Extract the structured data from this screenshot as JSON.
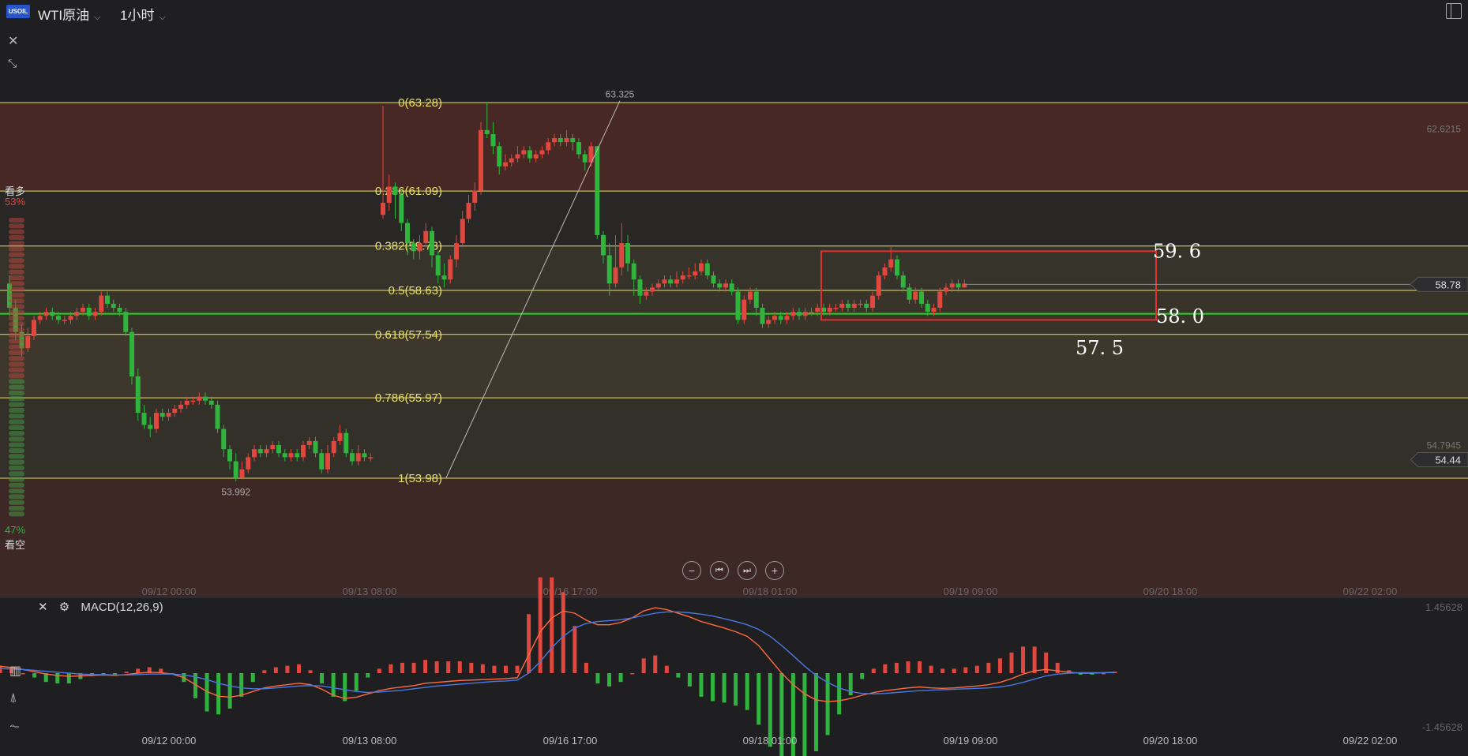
{
  "header": {
    "logo_text": "USOIL",
    "symbol": "WTI原油",
    "timeframe": "1小时"
  },
  "sentiment": {
    "bull_label": "看多",
    "bull_pct": "53%",
    "bear_label": "看空",
    "bear_pct": "47%",
    "bull_fraction": 0.53
  },
  "colors": {
    "up": "#e0473e",
    "down": "#2fb43e",
    "fib_line": "#e6e06a",
    "box": "#e03030",
    "support": "#22d622",
    "macd_fast": "#ff6a3d",
    "macd_slow": "#4a78e0"
  },
  "chart_data": [
    {
      "type": "candlestick",
      "symbol": "WTI原油",
      "interval": "1小时",
      "x_ticks": [
        "09/12 00:00",
        "09/13 08:00",
        "09/16 17:00",
        "09/18 01:00",
        "09/19 09:00",
        "09/20 18:00",
        "09/22 02:00"
      ],
      "y_labels": [
        "62.6215",
        "54.7945"
      ],
      "ylim": [
        51.5,
        65.5
      ],
      "price_tags": [
        {
          "value": 58.78,
          "label": "58.78"
        },
        {
          "value": 54.44,
          "label": "54.44"
        }
      ],
      "fib_levels": [
        {
          "label": "0(63.28)",
          "value": 63.28
        },
        {
          "label": "0.236(61.09)",
          "value": 61.09
        },
        {
          "label": "0.382(59.73)",
          "value": 59.73
        },
        {
          "label": "0.5(58.63)",
          "value": 58.63
        },
        {
          "label": "0.618(57.54)",
          "value": 57.54
        },
        {
          "label": "0.786(55.97)",
          "value": 55.97
        },
        {
          "label": "1(53.98)",
          "value": 53.98
        }
      ],
      "extremes": [
        {
          "label": "63.325",
          "value": 63.325
        },
        {
          "label": "53.992",
          "value": 53.992
        }
      ],
      "annotations": [
        {
          "label": "59. 6",
          "value": 59.6
        },
        {
          "label": "58. 0",
          "value": 58.0
        },
        {
          "label": "57. 5",
          "value": 57.5
        }
      ],
      "support_level": 58.05,
      "range_box": {
        "top": 59.6,
        "bottom": 57.9
      },
      "candles": [
        [
          58.8,
          58.2,
          59.0,
          58.0
        ],
        [
          58.2,
          57.6,
          58.4,
          57.4
        ],
        [
          57.6,
          57.2,
          57.8,
          57.0
        ],
        [
          57.2,
          57.5,
          57.7,
          57.1
        ],
        [
          57.5,
          57.9,
          58.0,
          57.4
        ],
        [
          57.9,
          58.0,
          58.1,
          57.8
        ],
        [
          58.0,
          58.1,
          58.2,
          57.9
        ],
        [
          58.1,
          58.0,
          58.2,
          57.9
        ],
        [
          58.0,
          57.9,
          58.1,
          57.8
        ],
        [
          57.9,
          57.9,
          58.0,
          57.8
        ],
        [
          57.9,
          58.0,
          58.1,
          57.8
        ],
        [
          58.0,
          58.1,
          58.2,
          57.9
        ],
        [
          58.1,
          58.2,
          58.3,
          58.0
        ],
        [
          58.2,
          58.0,
          58.3,
          57.9
        ],
        [
          58.0,
          58.1,
          58.2,
          57.9
        ],
        [
          58.1,
          58.5,
          58.6,
          58.0
        ],
        [
          58.5,
          58.3,
          58.6,
          58.2
        ],
        [
          58.3,
          58.2,
          58.4,
          58.1
        ],
        [
          58.2,
          58.1,
          58.3,
          58.0
        ],
        [
          58.1,
          57.6,
          58.2,
          57.5
        ],
        [
          57.6,
          56.5,
          57.7,
          56.3
        ],
        [
          56.5,
          55.6,
          56.7,
          55.4
        ],
        [
          55.6,
          55.3,
          55.8,
          55.2
        ],
        [
          55.3,
          55.2,
          55.5,
          55.0
        ],
        [
          55.2,
          55.6,
          55.7,
          55.1
        ],
        [
          55.6,
          55.5,
          55.7,
          55.4
        ],
        [
          55.5,
          55.6,
          55.7,
          55.4
        ],
        [
          55.6,
          55.7,
          55.8,
          55.5
        ],
        [
          55.7,
          55.8,
          55.9,
          55.6
        ],
        [
          55.8,
          55.9,
          56.0,
          55.7
        ],
        [
          55.9,
          55.9,
          56.0,
          55.8
        ],
        [
          55.9,
          56.0,
          56.1,
          55.8
        ],
        [
          56.0,
          55.9,
          56.1,
          55.8
        ],
        [
          55.9,
          55.8,
          56.0,
          55.7
        ],
        [
          55.8,
          55.2,
          55.9,
          55.1
        ],
        [
          55.2,
          54.7,
          55.3,
          54.5
        ],
        [
          54.7,
          54.4,
          54.8,
          54.2
        ],
        [
          54.4,
          54.0,
          54.6,
          53.9
        ],
        [
          54.0,
          54.2,
          54.4,
          54.0
        ],
        [
          54.2,
          54.5,
          54.6,
          54.1
        ],
        [
          54.5,
          54.7,
          54.8,
          54.4
        ],
        [
          54.7,
          54.6,
          54.8,
          54.5
        ],
        [
          54.6,
          54.7,
          54.8,
          54.5
        ],
        [
          54.7,
          54.8,
          54.9,
          54.6
        ],
        [
          54.8,
          54.6,
          54.9,
          54.5
        ],
        [
          54.6,
          54.5,
          54.7,
          54.4
        ],
        [
          54.5,
          54.6,
          54.7,
          54.4
        ],
        [
          54.6,
          54.5,
          54.7,
          54.4
        ],
        [
          54.5,
          54.8,
          54.9,
          54.4
        ],
        [
          54.8,
          54.9,
          55.0,
          54.7
        ],
        [
          54.9,
          54.6,
          55.0,
          54.5
        ],
        [
          54.6,
          54.2,
          54.7,
          54.1
        ],
        [
          54.2,
          54.6,
          54.8,
          54.1
        ],
        [
          54.6,
          54.9,
          55.0,
          54.5
        ],
        [
          54.9,
          55.1,
          55.3,
          54.8
        ],
        [
          55.1,
          54.6,
          55.2,
          54.5
        ],
        [
          54.6,
          54.4,
          54.7,
          54.3
        ],
        [
          54.4,
          54.6,
          54.8,
          54.3
        ],
        [
          54.6,
          54.5,
          54.7,
          54.4
        ],
        [
          54.5,
          54.5,
          54.6,
          54.4
        ],
        [
          60.5,
          60.8,
          63.2,
          60.4
        ],
        [
          60.8,
          61.2,
          61.5,
          60.6
        ],
        [
          61.2,
          61.0,
          61.3,
          60.4
        ],
        [
          61.0,
          60.3,
          61.1,
          60.1
        ],
        [
          60.3,
          59.8,
          60.4,
          59.5
        ],
        [
          59.8,
          59.6,
          59.9,
          59.4
        ],
        [
          59.6,
          59.8,
          60.0,
          59.4
        ],
        [
          59.8,
          60.1,
          60.3,
          59.7
        ],
        [
          60.1,
          59.5,
          60.2,
          59.2
        ],
        [
          59.5,
          59.0,
          59.6,
          58.8
        ],
        [
          59.0,
          58.9,
          59.3,
          58.7
        ],
        [
          58.9,
          59.4,
          59.5,
          58.8
        ],
        [
          59.4,
          59.8,
          60.0,
          59.2
        ],
        [
          59.8,
          60.4,
          60.6,
          59.7
        ],
        [
          60.4,
          60.8,
          61.0,
          60.3
        ],
        [
          60.8,
          61.1,
          61.3,
          60.6
        ],
        [
          61.1,
          62.6,
          62.8,
          61.0
        ],
        [
          62.6,
          62.5,
          63.3,
          62.4
        ],
        [
          62.5,
          62.2,
          62.8,
          62.0
        ],
        [
          62.2,
          61.7,
          62.3,
          61.5
        ],
        [
          61.7,
          61.8,
          62.0,
          61.6
        ],
        [
          61.8,
          61.9,
          62.0,
          61.7
        ],
        [
          61.9,
          62.0,
          62.2,
          61.8
        ],
        [
          62.0,
          62.1,
          62.2,
          61.9
        ],
        [
          62.1,
          61.9,
          62.2,
          61.8
        ],
        [
          61.9,
          62.0,
          62.1,
          61.8
        ],
        [
          62.0,
          62.1,
          62.2,
          61.9
        ],
        [
          62.1,
          62.3,
          62.4,
          62.0
        ],
        [
          62.3,
          62.4,
          62.5,
          62.2
        ],
        [
          62.4,
          62.3,
          62.5,
          62.2
        ],
        [
          62.3,
          62.4,
          62.6,
          62.2
        ],
        [
          62.4,
          62.3,
          62.5,
          62.1
        ],
        [
          62.3,
          62.0,
          62.4,
          61.9
        ],
        [
          62.0,
          61.8,
          62.1,
          61.6
        ],
        [
          61.8,
          62.2,
          62.3,
          61.7
        ],
        [
          62.2,
          60.0,
          62.2,
          59.9
        ],
        [
          60.0,
          59.5,
          60.1,
          59.3
        ],
        [
          59.5,
          58.8,
          59.8,
          58.5
        ],
        [
          58.8,
          59.2,
          60.0,
          58.7
        ],
        [
          59.2,
          59.8,
          60.3,
          59.0
        ],
        [
          59.8,
          59.3,
          60.0,
          59.1
        ],
        [
          59.3,
          58.9,
          59.4,
          58.5
        ],
        [
          58.9,
          58.5,
          59.0,
          58.3
        ],
        [
          58.5,
          58.6,
          58.7,
          58.4
        ],
        [
          58.6,
          58.7,
          58.8,
          58.5
        ],
        [
          58.7,
          58.8,
          58.9,
          58.6
        ],
        [
          58.8,
          58.9,
          59.0,
          58.7
        ],
        [
          58.9,
          58.8,
          59.0,
          58.7
        ],
        [
          58.8,
          58.9,
          59.1,
          58.7
        ],
        [
          58.9,
          59.0,
          59.1,
          58.8
        ],
        [
          59.0,
          59.0,
          59.2,
          58.9
        ],
        [
          59.0,
          59.1,
          59.3,
          58.9
        ],
        [
          59.1,
          59.3,
          59.4,
          59.0
        ],
        [
          59.3,
          59.0,
          59.4,
          58.9
        ],
        [
          59.0,
          58.8,
          59.1,
          58.7
        ],
        [
          58.8,
          58.7,
          58.9,
          58.6
        ],
        [
          58.7,
          58.8,
          58.9,
          58.6
        ],
        [
          58.8,
          58.6,
          58.9,
          58.5
        ],
        [
          58.6,
          57.9,
          58.7,
          57.8
        ],
        [
          57.9,
          58.4,
          58.5,
          57.8
        ],
        [
          58.4,
          58.6,
          58.7,
          58.3
        ],
        [
          58.6,
          58.2,
          58.7,
          58.0
        ],
        [
          58.2,
          57.8,
          58.3,
          57.7
        ],
        [
          57.8,
          57.9,
          58.0,
          57.7
        ],
        [
          57.9,
          58.0,
          58.1,
          57.8
        ],
        [
          58.0,
          57.9,
          58.1,
          57.8
        ],
        [
          57.9,
          58.0,
          58.1,
          57.8
        ],
        [
          58.0,
          58.1,
          58.2,
          57.9
        ],
        [
          58.1,
          58.0,
          58.2,
          57.9
        ],
        [
          58.0,
          58.1,
          58.2,
          57.9
        ],
        [
          58.1,
          58.1,
          58.2,
          58.0
        ],
        [
          58.1,
          58.2,
          58.3,
          58.0
        ],
        [
          58.2,
          58.1,
          58.3,
          58.0
        ],
        [
          58.1,
          58.2,
          58.3,
          58.0
        ],
        [
          58.2,
          58.2,
          58.3,
          58.1
        ],
        [
          58.2,
          58.3,
          58.4,
          58.1
        ],
        [
          58.3,
          58.2,
          58.4,
          58.1
        ],
        [
          58.2,
          58.3,
          58.4,
          58.1
        ],
        [
          58.3,
          58.3,
          58.4,
          58.2
        ],
        [
          58.3,
          58.2,
          58.4,
          58.1
        ],
        [
          58.2,
          58.5,
          58.6,
          58.1
        ],
        [
          58.5,
          59.0,
          59.1,
          58.4
        ],
        [
          59.0,
          59.2,
          59.3,
          58.9
        ],
        [
          59.2,
          59.4,
          59.7,
          59.1
        ],
        [
          59.4,
          59.0,
          59.5,
          58.9
        ],
        [
          59.0,
          58.7,
          59.1,
          58.6
        ],
        [
          58.7,
          58.4,
          58.8,
          58.3
        ],
        [
          58.4,
          58.6,
          58.7,
          58.3
        ],
        [
          58.6,
          58.3,
          58.7,
          58.2
        ],
        [
          58.3,
          58.1,
          58.4,
          58.0
        ],
        [
          58.1,
          58.2,
          58.3,
          58.0
        ],
        [
          58.2,
          58.6,
          58.7,
          58.1
        ],
        [
          58.6,
          58.7,
          58.8,
          58.5
        ],
        [
          58.7,
          58.8,
          58.9,
          58.6
        ],
        [
          58.8,
          58.7,
          58.9,
          58.6
        ],
        [
          58.7,
          58.8,
          58.9,
          58.7
        ]
      ],
      "candle_gap_after_index": 59
    },
    {
      "type": "line",
      "title": "MACD(12,26,9)",
      "y_labels": [
        "1.45628",
        "-1.45628"
      ],
      "ylim": [
        -1.45628,
        1.45628
      ],
      "x_ticks": [
        "09/12 00:00",
        "09/13 08:00",
        "09/16 17:00",
        "09/18 01:00",
        "09/19 09:00",
        "09/20 18:00",
        "09/22 02:00"
      ],
      "series": [
        {
          "values": [
            0.15,
            0.12,
            0.08,
            0.03,
            -0.02,
            -0.05,
            -0.07,
            -0.06,
            -0.05,
            -0.04,
            -0.05,
            -0.03,
            0.0,
            0.02,
            0.01,
            -0.02,
            -0.1,
            -0.25,
            -0.4,
            -0.5,
            -0.52,
            -0.48,
            -0.4,
            -0.32,
            -0.28,
            -0.25,
            -0.22,
            -0.25,
            -0.35,
            -0.48,
            -0.55,
            -0.52,
            -0.45,
            -0.38,
            -0.33,
            -0.3,
            -0.27,
            -0.22,
            -0.2,
            -0.18,
            -0.16,
            -0.15,
            -0.14,
            -0.13,
            -0.12,
            -0.1,
            0.4,
            0.9,
            1.2,
            1.35,
            1.3,
            1.15,
            1.05,
            1.05,
            1.1,
            1.2,
            1.35,
            1.42,
            1.38,
            1.3,
            1.22,
            1.12,
            1.05,
            0.98,
            0.9,
            0.8,
            0.6,
            0.3,
            0.0,
            -0.25,
            -0.45,
            -0.58,
            -0.62,
            -0.6,
            -0.55,
            -0.48,
            -0.42,
            -0.38,
            -0.35,
            -0.32,
            -0.3,
            -0.32,
            -0.33,
            -0.32,
            -0.3,
            -0.28,
            -0.25,
            -0.2,
            -0.12,
            -0.02,
            0.05,
            0.08,
            0.05,
            0.02,
            0.0,
            0.0,
            0.01,
            0.02
          ]
        },
        {
          "values": [
            0.1,
            0.09,
            0.08,
            0.06,
            0.04,
            0.02,
            0.0,
            -0.02,
            -0.03,
            -0.03,
            -0.04,
            -0.04,
            -0.03,
            -0.02,
            -0.02,
            -0.02,
            -0.04,
            -0.08,
            -0.14,
            -0.22,
            -0.28,
            -0.32,
            -0.34,
            -0.34,
            -0.32,
            -0.3,
            -0.28,
            -0.27,
            -0.28,
            -0.32,
            -0.36,
            -0.4,
            -0.42,
            -0.41,
            -0.39,
            -0.37,
            -0.34,
            -0.31,
            -0.28,
            -0.26,
            -0.24,
            -0.22,
            -0.2,
            -0.18,
            -0.17,
            -0.15,
            0.0,
            0.25,
            0.55,
            0.8,
            0.98,
            1.08,
            1.12,
            1.14,
            1.16,
            1.2,
            1.25,
            1.3,
            1.33,
            1.33,
            1.31,
            1.28,
            1.24,
            1.18,
            1.12,
            1.05,
            0.95,
            0.8,
            0.6,
            0.38,
            0.15,
            -0.05,
            -0.2,
            -0.32,
            -0.4,
            -0.44,
            -0.45,
            -0.44,
            -0.42,
            -0.4,
            -0.38,
            -0.37,
            -0.36,
            -0.35,
            -0.34,
            -0.33,
            -0.32,
            -0.3,
            -0.26,
            -0.2,
            -0.13,
            -0.06,
            -0.02,
            0.0,
            0.01,
            0.01,
            0.01,
            0.01
          ]
        }
      ]
    }
  ]
}
